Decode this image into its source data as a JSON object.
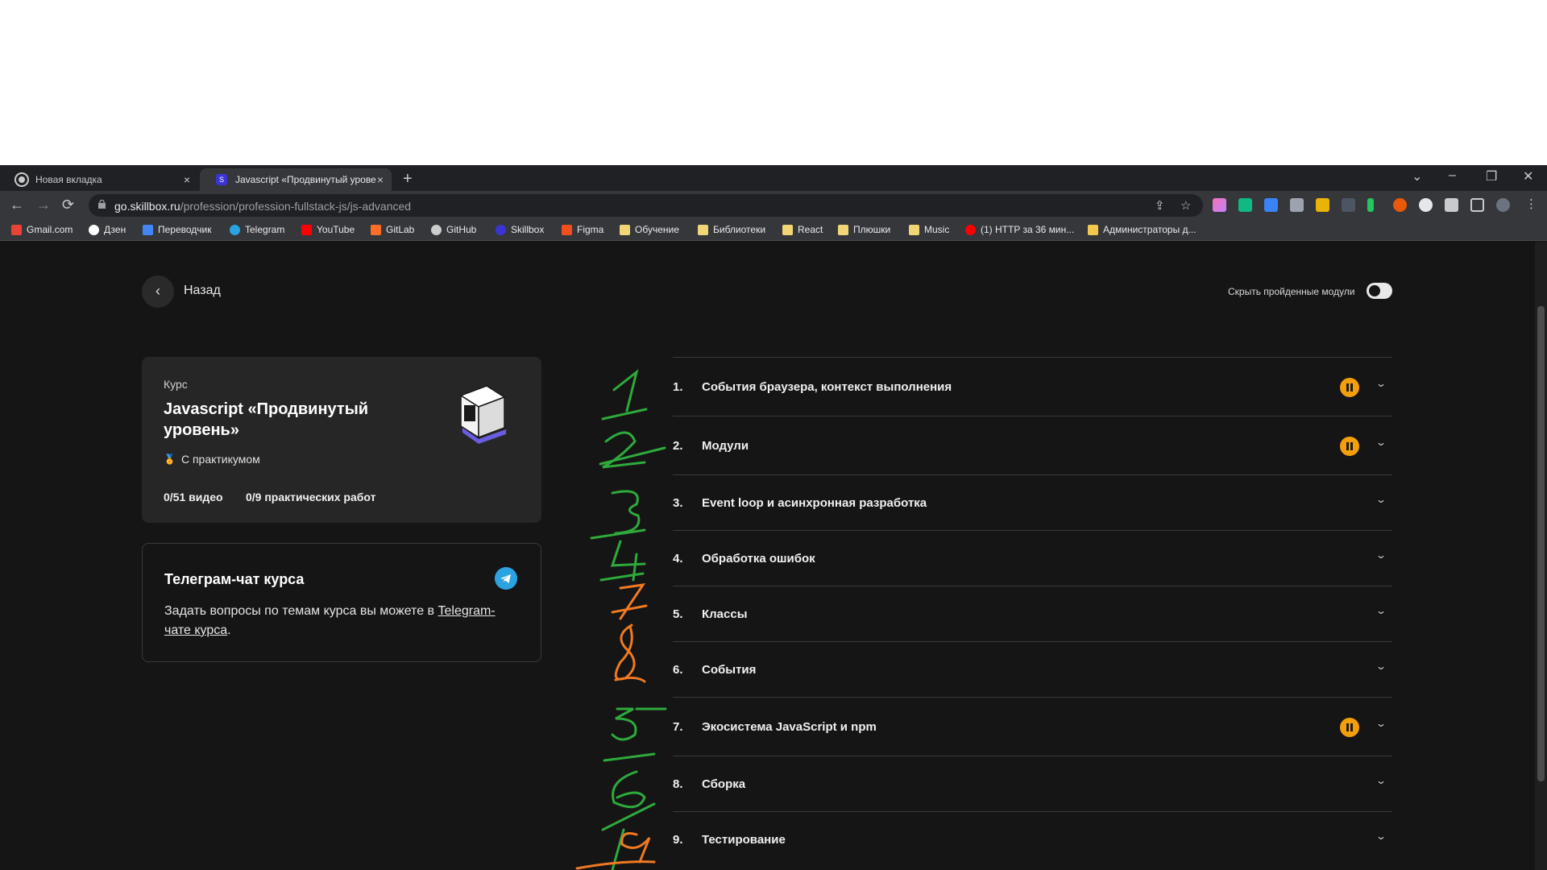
{
  "tabs": [
    {
      "title": "Новая вкладка",
      "close": "×"
    },
    {
      "title": "Javascript «Продвинутый уровень»",
      "favicon": "S",
      "close": "×"
    }
  ],
  "window": {
    "new_tab": "+",
    "menu": "⌄",
    "minimize": "–",
    "restore": "❐",
    "close": "✕"
  },
  "toolbar": {
    "back": "←",
    "forward": "→",
    "reload": "⟳",
    "url_host": "go.skillbox.ru",
    "url_path": "/profession/profession-fullstack-js/js-advanced",
    "share_icon": "share-icon",
    "star_icon": "star-icon",
    "extensions_icon": "puzzle-icon",
    "sidepanel_icon": "sidepanel-icon",
    "menu_icon": "kebab-icon"
  },
  "bookmarks": [
    {
      "label": "Gmail.com",
      "color": "#ea4335"
    },
    {
      "label": "Дзен",
      "color": "#ffffff"
    },
    {
      "label": "Переводчик",
      "color": "#4285f4"
    },
    {
      "label": "Telegram",
      "color": "#2aa3e0"
    },
    {
      "label": "YouTube",
      "color": "#ff0000"
    },
    {
      "label": "GitLab",
      "color": "#fc6d26"
    },
    {
      "label": "GitHub",
      "color": "#cccccc"
    },
    {
      "label": "Skillbox",
      "color": "#3b33d6"
    },
    {
      "label": "Figma",
      "color": "#f24e1e"
    },
    {
      "label": "Обучение",
      "color": "#f2d675"
    },
    {
      "label": "Библиотеки",
      "color": "#f2d675"
    },
    {
      "label": "React",
      "color": "#f2d675"
    },
    {
      "label": "Плюшки",
      "color": "#f2d675"
    },
    {
      "label": "Music",
      "color": "#f2d675"
    },
    {
      "label": "(1) HTTP за 36 мин...",
      "color": "#ff0000"
    },
    {
      "label": "Администраторы д...",
      "color": "#f2c94c"
    }
  ],
  "page": {
    "back_label": "Назад",
    "hide_completed_label": "Скрыть пройденные модули",
    "hide_completed_on": false
  },
  "course": {
    "kicker": "Курс",
    "title": "Javascript «Продвинутый уровень»",
    "tag": "С практикумом",
    "videos": "0/51 видео",
    "practice": "0/9 практических работ"
  },
  "telegram": {
    "title": "Телеграм-чат курса",
    "text_before": "Задать вопросы по темам курса вы можете в ",
    "link_text": "Telegram-чате курса",
    "text_after": "."
  },
  "modules": [
    {
      "num": "1.",
      "name": "События браузера, контекст выполнения",
      "in_progress": true
    },
    {
      "num": "2.",
      "name": "Модули",
      "in_progress": true
    },
    {
      "num": "3.",
      "name": "Event loop и асинхронная разработка",
      "in_progress": false
    },
    {
      "num": "4.",
      "name": "Обработка ошибок",
      "in_progress": false
    },
    {
      "num": "5.",
      "name": "Классы",
      "in_progress": false
    },
    {
      "num": "6.",
      "name": "События",
      "in_progress": false
    },
    {
      "num": "7.",
      "name": "Экосистема JavaScript и npm",
      "in_progress": true
    },
    {
      "num": "8.",
      "name": "Сборка",
      "in_progress": false
    },
    {
      "num": "9.",
      "name": "Тестирование",
      "in_progress": false
    }
  ],
  "colors": {
    "accent": "#f59e0b",
    "telegram": "#2aa3e0",
    "annotation_green": "#2eaa3c",
    "annotation_orange": "#f07a22"
  }
}
